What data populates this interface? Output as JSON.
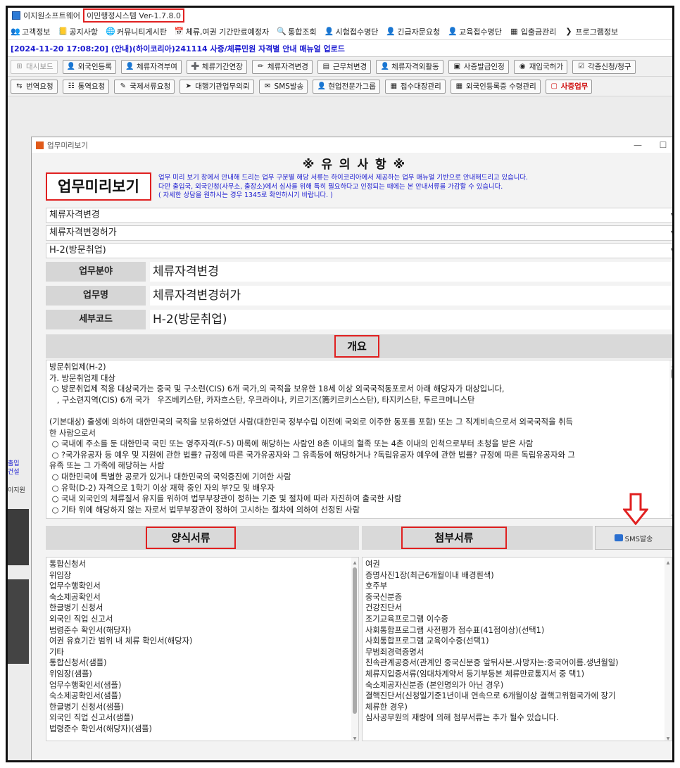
{
  "app": {
    "name": "이지원소프트웨어",
    "version": "이민행정시스템 Ver-1.7.8.0"
  },
  "menu": [
    {
      "icon": "people-icon",
      "glyph": "👥",
      "label": "고객정보"
    },
    {
      "icon": "notice-icon",
      "glyph": "📒",
      "label": "공지사항"
    },
    {
      "icon": "globe-icon",
      "glyph": "🌐",
      "label": "커뮤니티게시판"
    },
    {
      "icon": "calendar-icon",
      "glyph": "📅",
      "label": "체류,여권 기간만료예정자"
    },
    {
      "icon": "search-icon",
      "glyph": "🔍",
      "label": "통합조회"
    },
    {
      "icon": "person-icon",
      "glyph": "👤",
      "label": "시험접수명단"
    },
    {
      "icon": "person-alert-icon",
      "glyph": "👤",
      "label": "긴급자문요청"
    },
    {
      "icon": "person-edu-icon",
      "glyph": "👤",
      "label": "교육접수명단"
    },
    {
      "icon": "table-icon",
      "glyph": "▦",
      "label": "입출금관리"
    },
    {
      "icon": "arrow-icon",
      "glyph": "❯",
      "label": "프로그램정보"
    }
  ],
  "notice": "[2024-11-20 17:08:20] (안내)(하이코리아)241114 사증/체류민원 자격별 안내 매뉴얼 업로드",
  "toolbar1": [
    {
      "icon": "dashboard-icon",
      "glyph": "⊞",
      "label": "대시보드",
      "disabled": true
    },
    {
      "icon": "person-register-icon",
      "glyph": "👤",
      "label": "외국인등록"
    },
    {
      "icon": "person-grant-icon",
      "glyph": "👤",
      "label": "체류자격부여"
    },
    {
      "icon": "plus-icon",
      "glyph": "➕",
      "label": "체류기간연장"
    },
    {
      "icon": "pencil-icon",
      "glyph": "✏",
      "label": "체류자격변경"
    },
    {
      "icon": "workplace-icon",
      "glyph": "▤",
      "label": "근무처변경"
    },
    {
      "icon": "person-activity-icon",
      "glyph": "👤",
      "label": "체류자격외활동"
    },
    {
      "icon": "certificate-icon",
      "glyph": "▣",
      "label": "사증발급인정"
    },
    {
      "icon": "reentry-icon",
      "glyph": "◉",
      "label": "재입국허가"
    },
    {
      "icon": "checklist-icon",
      "glyph": "☑",
      "label": "각종신청/청구"
    }
  ],
  "toolbar2": [
    {
      "icon": "translate-icon",
      "glyph": "⇆",
      "label": "번역요청"
    },
    {
      "icon": "interpret-icon",
      "glyph": "☷",
      "label": "통역요청"
    },
    {
      "icon": "document-request-icon",
      "glyph": "✎",
      "label": "국제서류요청"
    },
    {
      "icon": "proxy-icon",
      "glyph": "➤",
      "label": "대행기관업무의뢰"
    },
    {
      "icon": "sms-icon",
      "glyph": "✉",
      "label": "SMS발송"
    },
    {
      "icon": "expert-group-icon",
      "glyph": "👤",
      "label": "현업전문가그룹"
    },
    {
      "icon": "reception-icon",
      "glyph": "▦",
      "label": "접수대장관리"
    },
    {
      "icon": "receipt-icon",
      "glyph": "▦",
      "label": "외국인등록증 수령관리"
    },
    {
      "icon": "visa-task-icon",
      "glyph": "▢",
      "label": "사증업무",
      "highlight": true
    }
  ],
  "left_strip": [
    "출입",
    "건설",
    "이지원"
  ],
  "dialog": {
    "title": "업무미리보기",
    "caution_title": "※ 유 의 사 항 ※",
    "big_title": "업무미리보기",
    "caution_lines": [
      "업무 미리 보기 창에서 안내해 드리는 업무 구분별 해당 서류는 하이코리아에서 제공하는 업무 매뉴얼 기반으로 안내해드리고 있습니다.",
      "다만 출입국, 외국인청(사무소, 출장소)에서 심사를 위해 특히 필요하다고 인정되는 때에는 본 안내서류를 가감할 수 있습니다.",
      "( 자세한 상담을 원하시는 경우 1345로 확인하시기 바랍니다. )"
    ],
    "dropdowns": [
      "체류자격변경",
      "체류자격변경허가",
      "H-2(방문취업)"
    ],
    "fields": [
      {
        "label": "업무분야",
        "value": "체류자격변경"
      },
      {
        "label": "업무명",
        "value": "체류자격변경허가"
      },
      {
        "label": "세부코드",
        "value": "H-2(방문취업)"
      }
    ],
    "overview_label": "개요",
    "overview_lines": [
      "방문취업제(H-2)",
      "가. 방문취업제 대상",
      " ○ 방문취업제 적용 대상국가는 중국 및 구소련(CIS) 6개 국가,의 국적을 보유한 18세 이상 외국국적동포로서 아래 해당자가 대상입니다,",
      "   , 구소련지역(CIS) 6개 국가   우즈베키스탄, 카자흐스탄, 우크라이나, 키르기즈(籌키르키스스탄), 타지키스탄, 투르크메니스탄",
      "",
      "(기본대상) 출생에 의하여 대한민국의 국적을 보유하였던 사람(대한민국 정부수립 이전에 국외로 이주한 동포를 포함) 또는 그 직계비속으로서 외국국적을 취득",
      "한 사람으로서",
      " ○ 국내에 주소를 둔 대한민국 국민 또는 영주자격(F-5) 마록에 해당하는 사람인 8촌 이내의 혈족 또는 4촌 이내의 인척으로부터 초청을 받은 사람",
      " ○ ?국가유공자 등 예우 및 지원에 관한 법률? 규정에 따른 국가유공자와 그 유족등에 해당하거나 ?독립유공자 예우에 관한 법률? 규정에 따른 독립유공자와 그",
      "유족 또는 그 가족에 해당하는 사람",
      " ○ 대한민국에 특별한 공로가 있거나 대한민국의 국익증진에 기여한 사람",
      " ○ 유학(D-2) 자격으로 1학기 이상 재학 중인 자의 부?모 및 배우자",
      " ○ 국내 외국인의 체류질서 유지를 위하여 법무부장관이 정하는 기준 및 절차에 따라 자진하여 출국한 사람",
      " ○ 기타 위에 해당하지 않는 자로서 법무부장관이 정하여 고시하는 절차에 의하여 선정된 사람"
    ],
    "forms_label": "양식서류",
    "attach_label": "첨부서류",
    "sms_button": "SMS발송",
    "forms": [
      "통합신청서",
      "위임장",
      "업무수행확인서",
      "숙소제공확인서",
      "한글병기 신청서",
      "외국인 직업 신고서",
      "법령준수 확인서(해당자)",
      "여권 유효기간 범위 내 체류 확인서(해당자)",
      "기타",
      "통합신청서(샘플)",
      "위임장(샘플)",
      "업무수행확인서(샘플)",
      "숙소제공확인서(샘플)",
      "한글병기 신청서(샘플)",
      "외국인 직업 신고서(샘플)",
      "법령준수 확인서(해당자)(샘플)"
    ],
    "attachments": [
      "여권",
      "증명사진1장(최근6개월이내 배경흰색)",
      "호주부",
      "중국신분증",
      "건강진단서",
      "조기교육프로그램 이수증",
      "사회통합프로그램 사전평가 점수표(41점이상)(선택1)",
      "사회통합프로그램 교육이수증(선택1)",
      "무범죄경력증명서",
      "친속관계공증서(관계인 중국신분증 앞뒤사본.사망자는:중국어이름.생년월일)",
      "체류지입증서류(임대차계약서 등기부등본 체류만료통지서 중 택1)",
      "숙소제공자신분증 (본인명의가 아닌 경우)",
      "결핵진단서(신청일기준1년이내 연속으로 6개월이상 결핵고위험국가에 장기",
      "체류한 경우)",
      "심사공무원의 재량에 의해 첨부서류는 추가 될수 있습니다."
    ]
  }
}
